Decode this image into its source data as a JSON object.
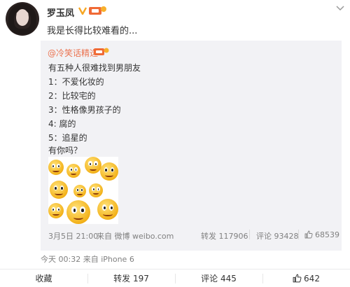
{
  "post": {
    "author": "罗玉凤",
    "text": "我是长得比较难看的...",
    "time": "今天 00:32 来自 iPhone 6"
  },
  "repost": {
    "author": "@冷笑话精选",
    "lines": [
      "有五种人很难找到男朋友",
      "1：不爱化妆的",
      "2：比较宅的",
      "3：性格像男孩子的",
      "4: 腐的",
      "5：追星的",
      "有你吗？"
    ],
    "time": "3月5日 21:00",
    "source": "来自 微博 weibo.com",
    "forward_label": "转发 117906",
    "comment_label": "评论 93428",
    "like_count": "68539"
  },
  "actions": {
    "favorite": "收藏",
    "forward": "转发 197",
    "comment": "评论 445",
    "like": "642"
  },
  "colors": {
    "author_link": "#eb7350",
    "verified": "#f6a623",
    "muted": "#808080",
    "repost_bg": "#f2f2f5"
  },
  "icons": [
    "avatar",
    "verified-icon",
    "vip-icon",
    "dropdown-icon",
    "thumb-up-icon"
  ]
}
